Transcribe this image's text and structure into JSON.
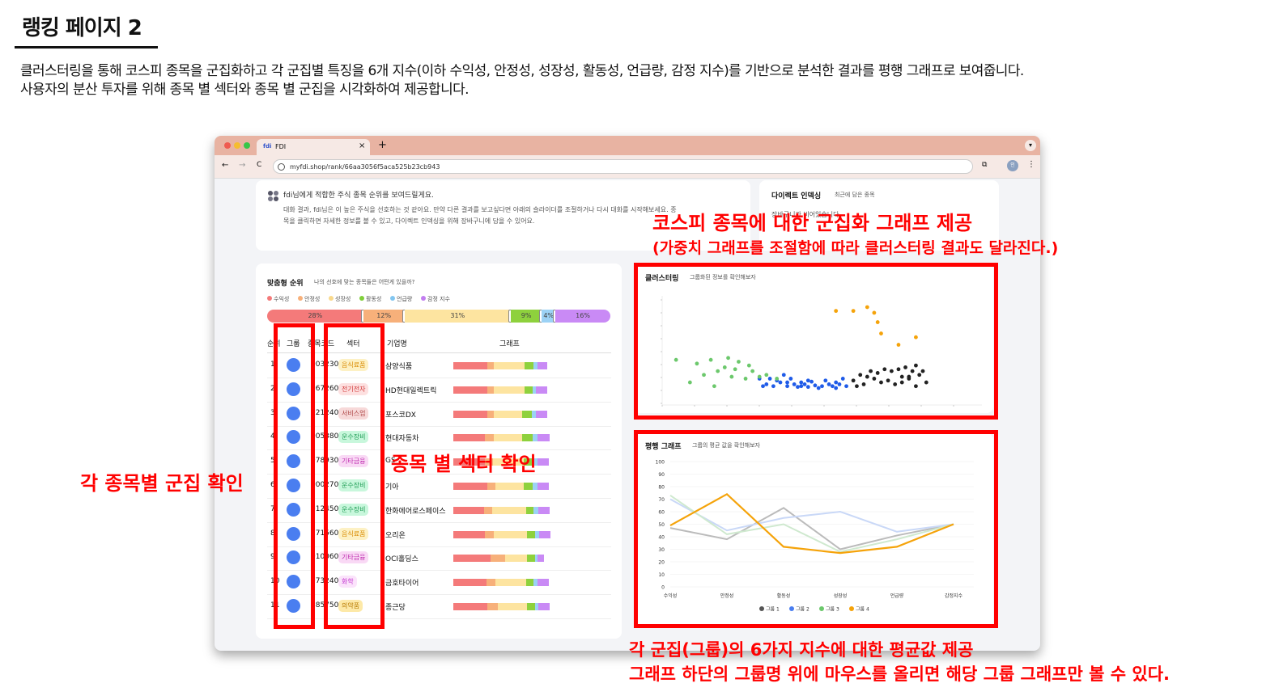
{
  "page": {
    "title": "랭킹 페이지 2",
    "description_line1": "클러스터링을 통해 코스피 종목을 군집화하고 각 군집별 특징을 6개 지수(이하 수익성, 안정성, 성장성, 활동성, 언급량, 감정 지수)를 기반으로 분석한 결과를 평행 그래프로 보여줍니다.",
    "description_line2": "사용자의 분산 투자를 위해 종목 별 섹터와 종목 별 군집을 시각화하여 제공합니다."
  },
  "browser": {
    "tab_title": "FDI",
    "tab_close": "×",
    "new_tab": "+",
    "url": "myfdi.shop/rank/66aa3056f5aca525b23cb943",
    "back": "←",
    "forward": "→",
    "reload": "C",
    "profile": "인",
    "menu": "⋮"
  },
  "intro": {
    "heading": "fdi님에게 적합한 주식 종목 순위를 보여드릴게요.",
    "body1": "대화 결과, fdi님은 이 높은 주식을 선호하는 것 같아요. 만약 다른 결과를 보고싶다면 아래의 슬라이더를 조절하거나 다시 대화를 시작해보세요. 종",
    "body2": "목을 클릭하면 자세한 정보를 볼 수 있고, 다이렉트 인덱싱을 위해 장바구니에 담을 수 있어요."
  },
  "direct_indexing": {
    "title": "다이렉트 인덱싱",
    "subtitle": "최근에 담은 종목",
    "body": "장바구니가 비어있습니다."
  },
  "ranking": {
    "title": "맞춤형 순위",
    "subtitle": "나의 선호에 맞는 종목들은 어떤게 있을까?",
    "legend": [
      {
        "label": "수익성",
        "color": "#f47a7a"
      },
      {
        "label": "안정성",
        "color": "#f7b07a"
      },
      {
        "label": "성장성",
        "color": "#f9d98c"
      },
      {
        "label": "활동성",
        "color": "#7fcf3a"
      },
      {
        "label": "언급량",
        "color": "#82c6f0"
      },
      {
        "label": "감정 지수",
        "color": "#c27ef0"
      }
    ],
    "weights": [
      {
        "label": "28%",
        "value": 28,
        "color": "#f47a7a"
      },
      {
        "label": "12%",
        "value": 12,
        "color": "#f7b07a"
      },
      {
        "label": "31%",
        "value": 31,
        "color": "#fde4a0"
      },
      {
        "label": "9%",
        "value": 9,
        "color": "#8ed13d"
      },
      {
        "label": "4%",
        "value": 4,
        "color": "#9cd2f5"
      },
      {
        "label": "16%",
        "value": 16,
        "color": "#c98af5"
      }
    ],
    "columns": {
      "rank": "순위",
      "group": "그룹",
      "code": "종목코드",
      "sector": "섹터",
      "company": "기업명",
      "graph": "그래프"
    },
    "rows": [
      {
        "rank": "1",
        "code": "003230",
        "sector": "음식료품",
        "company": "삼양식품",
        "weights": [
          0.3,
          0.06,
          0.27,
          0.08,
          0.03,
          0.09
        ]
      },
      {
        "rank": "2",
        "code": "267260",
        "sector": "전기전자",
        "company": "HD현대일렉트릭",
        "weights": [
          0.3,
          0.06,
          0.27,
          0.07,
          0.03,
          0.1
        ]
      },
      {
        "rank": "3",
        "code": "021240",
        "sector": "서비스업",
        "company": "포스코DX",
        "weights": [
          0.3,
          0.06,
          0.25,
          0.08,
          0.04,
          0.1
        ]
      },
      {
        "rank": "4",
        "code": "005380",
        "sector": "운수장비",
        "company": "현대자동차",
        "weights": [
          0.28,
          0.08,
          0.25,
          0.09,
          0.04,
          0.11
        ]
      },
      {
        "rank": "5",
        "code": "078930",
        "sector": "기타금융",
        "company": "GS",
        "weights": [
          0.28,
          0.07,
          0.27,
          0.08,
          0.04,
          0.1
        ]
      },
      {
        "rank": "6",
        "code": "000270",
        "sector": "운수장비",
        "company": "기아",
        "weights": [
          0.3,
          0.07,
          0.25,
          0.08,
          0.04,
          0.1
        ]
      },
      {
        "rank": "7",
        "code": "012450",
        "sector": "운수장비",
        "company": "한화에어로스페이스",
        "weights": [
          0.27,
          0.07,
          0.3,
          0.07,
          0.04,
          0.1
        ]
      },
      {
        "rank": "8",
        "code": "271560",
        "sector": "음식료품",
        "company": "오리온",
        "weights": [
          0.28,
          0.08,
          0.29,
          0.07,
          0.04,
          0.1
        ]
      },
      {
        "rank": "9",
        "code": "010060",
        "sector": "기타금융",
        "company": "OCI홀딩스",
        "weights": [
          0.33,
          0.13,
          0.19,
          0.07,
          0.02,
          0.06
        ]
      },
      {
        "rank": "10",
        "code": "073240",
        "sector": "화학",
        "company": "금호타이어",
        "weights": [
          0.29,
          0.08,
          0.27,
          0.07,
          0.03,
          0.1
        ]
      },
      {
        "rank": "11",
        "code": "185750",
        "sector": "의약품",
        "company": "종근당",
        "weights": [
          0.3,
          0.09,
          0.26,
          0.07,
          0.03,
          0.1
        ]
      }
    ]
  },
  "sector_styles": {
    "음식료품": {
      "bg": "#fdf1c4",
      "fg": "#d98a00"
    },
    "전기전자": {
      "bg": "#fde0e0",
      "fg": "#d23b3b"
    },
    "서비스업": {
      "bg": "#f7d9d9",
      "fg": "#b04a4a"
    },
    "운수장비": {
      "bg": "#c8f7dc",
      "fg": "#1f9d55"
    },
    "기타금융": {
      "bg": "#f9d9f5",
      "fg": "#c02fb0"
    },
    "화학": {
      "bg": "#fbe3fb",
      "fg": "#c43ad0"
    },
    "의약품": {
      "bg": "#fde9a8",
      "fg": "#b87a00"
    }
  },
  "cluster": {
    "title": "클러스터링",
    "subtitle": "그룹화된 정보를 확인해보자"
  },
  "parallel": {
    "title": "평행 그래프",
    "subtitle": "그룹의 평균 값을 확인해보자"
  },
  "chart_data": [
    {
      "type": "scatter",
      "title": "클러스터링",
      "series": [
        {
          "name": "그룹1",
          "color": "#222222",
          "points": [
            [
              5.55,
              4.45
            ],
            [
              5.65,
              4.6
            ],
            [
              5.75,
              4.55
            ],
            [
              5.85,
              4.5
            ],
            [
              5.95,
              4.4
            ],
            [
              6.05,
              4.45
            ],
            [
              6.15,
              4.35
            ],
            [
              6.25,
              4.55
            ],
            [
              6.35,
              4.5
            ],
            [
              6.45,
              4.3
            ],
            [
              6.5,
              4.6
            ],
            [
              6.55,
              4.7
            ],
            [
              6.6,
              4.4
            ],
            [
              6.1,
              4.7
            ],
            [
              6.2,
              4.75
            ],
            [
              6.3,
              4.8
            ],
            [
              6.4,
              4.7
            ],
            [
              5.9,
              4.65
            ],
            [
              5.8,
              4.7
            ],
            [
              6.0,
              4.75
            ],
            [
              6.45,
              4.85
            ],
            [
              6.35,
              4.55
            ],
            [
              5.7,
              4.35
            ],
            [
              5.6,
              4.3
            ],
            [
              6.25,
              4.4
            ]
          ]
        },
        {
          "name": "그룹2",
          "color": "#1f5be8",
          "points": [
            [
              4.2,
              4.5
            ],
            [
              4.3,
              4.35
            ],
            [
              4.4,
              4.3
            ],
            [
              4.5,
              4.4
            ],
            [
              4.6,
              4.3
            ],
            [
              4.7,
              4.35
            ],
            [
              4.8,
              4.3
            ],
            [
              4.9,
              4.28
            ],
            [
              5.0,
              4.32
            ],
            [
              5.1,
              4.3
            ],
            [
              5.2,
              4.35
            ],
            [
              5.3,
              4.4
            ],
            [
              5.4,
              4.5
            ],
            [
              4.55,
              4.6
            ],
            [
              4.45,
              4.45
            ],
            [
              4.35,
              4.5
            ],
            [
              4.65,
              4.5
            ],
            [
              4.75,
              4.28
            ],
            [
              4.85,
              4.35
            ],
            [
              4.95,
              4.42
            ],
            [
              5.05,
              4.25
            ],
            [
              5.15,
              4.45
            ],
            [
              5.25,
              4.3
            ],
            [
              5.35,
              4.35
            ],
            [
              4.25,
              4.3
            ],
            [
              4.6,
              4.4
            ],
            [
              4.9,
              4.45
            ],
            [
              5.45,
              4.3
            ],
            [
              5.3,
              4.25
            ],
            [
              4.8,
              4.4
            ]
          ]
        },
        {
          "name": "그룹3",
          "color": "#6cc86c",
          "points": [
            [
              3.0,
              5.0
            ],
            [
              3.3,
              4.9
            ],
            [
              3.5,
              5.0
            ],
            [
              3.7,
              4.8
            ],
            [
              3.9,
              4.95
            ],
            [
              4.1,
              4.7
            ],
            [
              4.3,
              4.6
            ],
            [
              3.4,
              4.6
            ],
            [
              3.6,
              4.7
            ],
            [
              3.8,
              4.55
            ],
            [
              4.0,
              4.5
            ],
            [
              4.2,
              4.55
            ],
            [
              3.2,
              4.4
            ],
            [
              3.55,
              4.3
            ],
            [
              3.85,
              4.75
            ],
            [
              4.45,
              4.5
            ],
            [
              3.75,
              5.05
            ],
            [
              4.05,
              4.85
            ]
          ]
        },
        {
          "name": "그룹4",
          "color": "#f5a30a",
          "points": [
            [
              5.3,
              6.3
            ],
            [
              5.55,
              6.3
            ],
            [
              5.75,
              6.4
            ],
            [
              5.85,
              6.25
            ],
            [
              5.95,
              5.7
            ],
            [
              5.9,
              6.0
            ],
            [
              6.2,
              5.4
            ],
            [
              6.45,
              5.6
            ]
          ]
        }
      ]
    },
    {
      "type": "line",
      "title": "평행 그래프",
      "categories": [
        "수익성",
        "안정성",
        "활동성",
        "성장성",
        "언급량",
        "감정지수"
      ],
      "ylim": [
        0,
        100
      ],
      "yticks": [
        "0",
        "10",
        "20",
        "30",
        "40",
        "50",
        "60",
        "70",
        "80",
        "90",
        "100"
      ],
      "legend": [
        "그룹 1",
        "그룹 2",
        "그룹 3",
        "그룹 4"
      ],
      "series": [
        {
          "name": "그룹 1",
          "color": "#bbbbbb",
          "values": [
            47,
            38,
            63,
            30,
            41,
            50
          ]
        },
        {
          "name": "그룹 2",
          "color": "#c9d8f7",
          "values": [
            70,
            45,
            55,
            60,
            44,
            50
          ]
        },
        {
          "name": "그룹 3",
          "color": "#cfe9cf",
          "values": [
            73,
            42,
            50,
            28,
            38,
            50
          ]
        },
        {
          "name": "그룹 4",
          "color": "#f5a30a",
          "values": [
            49,
            74,
            32,
            27,
            32,
            50
          ]
        }
      ]
    }
  ],
  "annotations": {
    "cluster_title": "코스피 종목에 대한 군집화 그래프 제공",
    "cluster_sub": "(가중치 그래프를 조절함에 따라 클러스터링 결과도 달라진다.)",
    "group_label": "각 종목별 군집 확인",
    "sector_label": "종목 별 섹터 확인",
    "parallel_line1": "각 군집(그룹)의 6가지 지수에 대한 평균값 제공",
    "parallel_line2": "그래프 하단의 그룹명 위에 마우스를 올리면 해당 그룹 그래프만 볼 수 있다."
  },
  "colors": {
    "annotation_red": "#ff0000",
    "group_dot": "#4a7ef0"
  }
}
